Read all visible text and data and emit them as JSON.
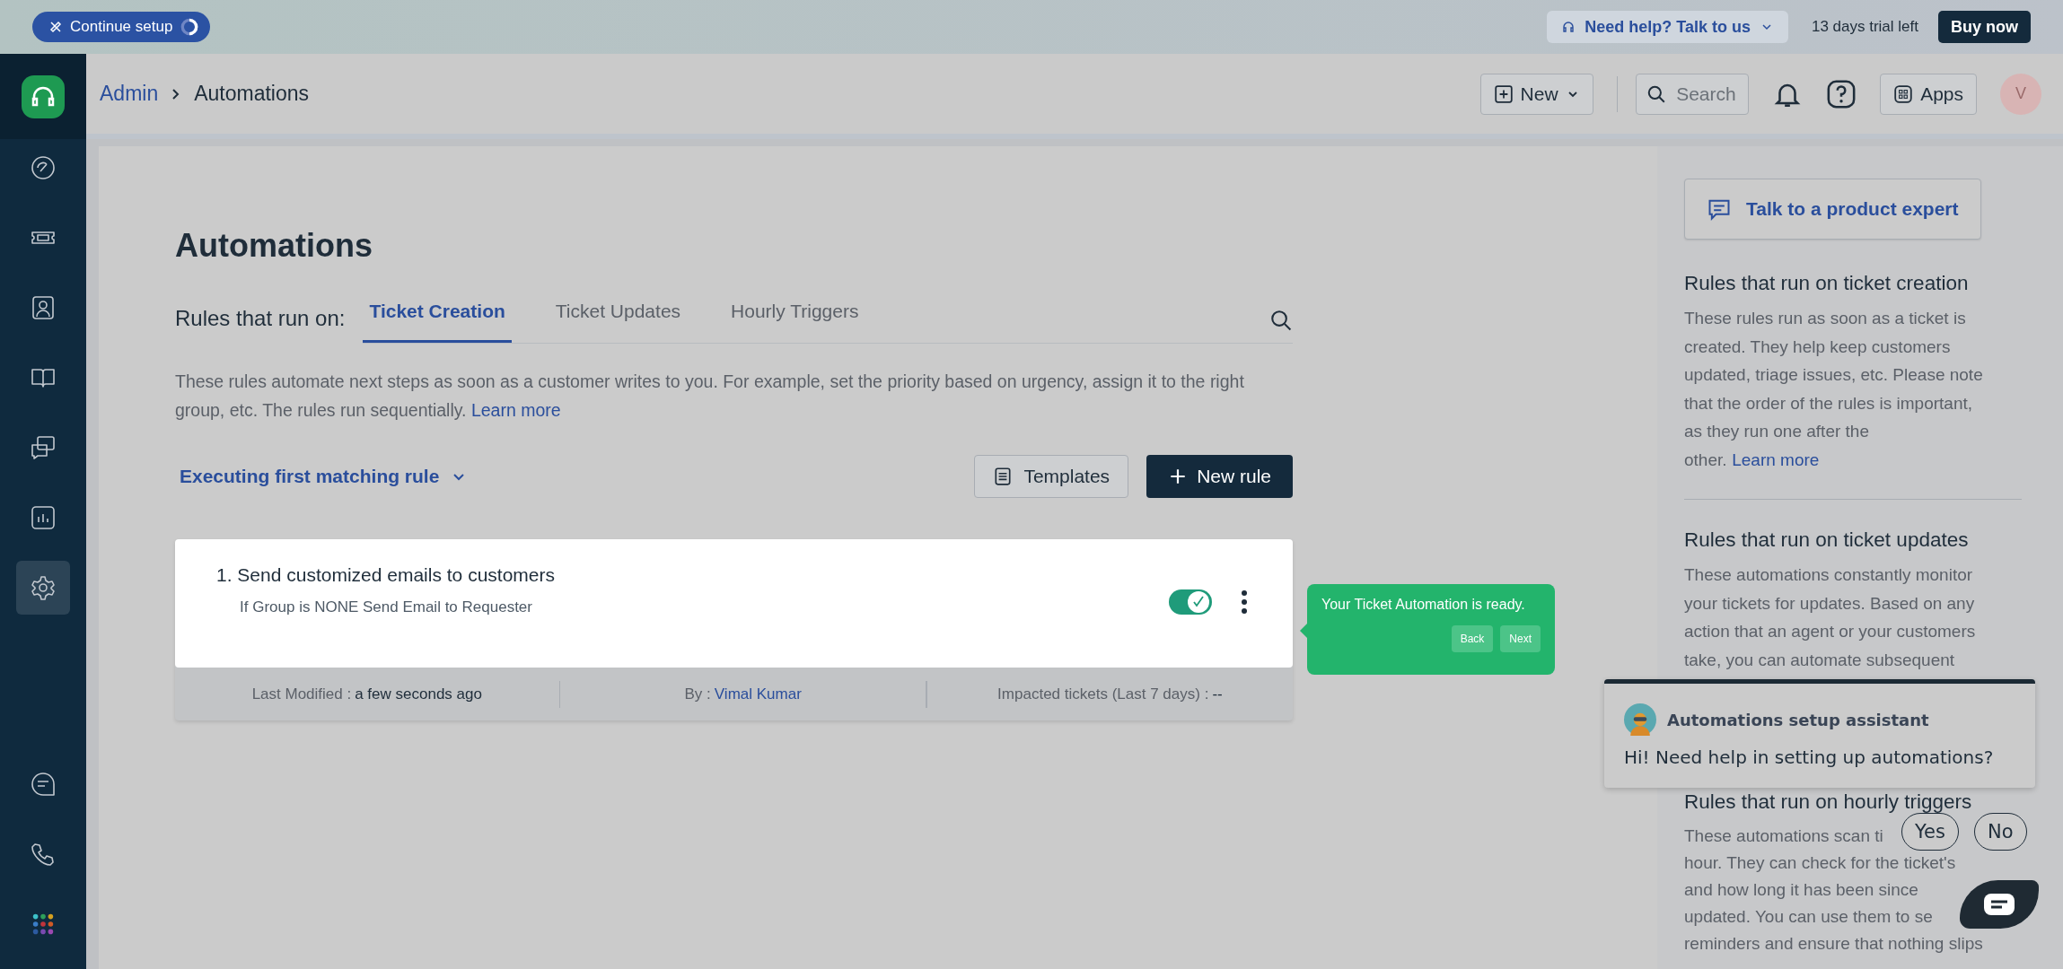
{
  "top_bar": {
    "setup_button": "Continue setup",
    "help_button": "Need help? Talk to us",
    "trial": "13 days trial left",
    "buy_button": "Buy now"
  },
  "sidebar": {
    "items": [
      {
        "kind": "dashboard",
        "selected": false
      },
      {
        "kind": "tickets",
        "selected": false
      },
      {
        "kind": "contacts",
        "selected": false
      },
      {
        "kind": "solutions",
        "selected": false
      },
      {
        "kind": "conversations",
        "selected": false
      },
      {
        "kind": "reports",
        "selected": false
      },
      {
        "kind": "admin",
        "selected": true
      }
    ],
    "bottom_items": [
      {
        "kind": "chat"
      },
      {
        "kind": "phone"
      },
      {
        "kind": "apps"
      }
    ]
  },
  "header": {
    "breadcrumb": [
      "Admin",
      "Automations"
    ],
    "new_button": "New",
    "search_placeholder": "Search",
    "apps_button": "Apps",
    "avatar": "V"
  },
  "page": {
    "title": "Automations",
    "tabs_label": "Rules that run on:",
    "tabs": [
      {
        "label": "Ticket Creation",
        "selected": true
      },
      {
        "label": "Ticket Updates",
        "selected": false
      },
      {
        "label": "Hourly Triggers",
        "selected": false
      }
    ],
    "description": "These rules automate next steps as soon as a customer writes to you. For example, set the priority based on urgency, assign it to the right group, etc. The rules run sequentially.",
    "learn_more": "Learn more",
    "execution_mode": "Executing first matching rule",
    "templates_button": "Templates",
    "new_rule_button": "New rule"
  },
  "rules": [
    {
      "number": "1.",
      "name": "Send customized emails to customers",
      "summary": "If Group is NONE Send Email to Requester",
      "enabled": true,
      "last_modified_label": "Last Modified :",
      "last_modified": "a few seconds ago",
      "by_label": "By :",
      "by": "Vimal Kumar",
      "impacted_label": "Impacted tickets (Last 7 days) :",
      "impacted": "--"
    }
  ],
  "tour_tooltip": {
    "text": "Your Ticket Automation is ready.",
    "back": "Back",
    "next": "Next"
  },
  "help_panel": {
    "expert_button": "Talk to a product expert",
    "sections": [
      {
        "title": "Rules that run on ticket creation",
        "lines": [
          "These rules run as soon as a ticket is created. They help keep customers updated, triage issues, etc. Please note that the order of the rules is important, as they run one after the other."
        ],
        "link": "Learn more"
      },
      {
        "title": "Rules that run on ticket updates",
        "lines": [
          "These automations constantly monitor your tickets for updates. Based on any action that an agent or your customers take, you can automate subsequent"
        ]
      },
      {
        "title": "Rules that run on hourly triggers",
        "lines": [
          "These automations scan ti",
          "hour. They can check for the ticket's",
          "and how long it has been since",
          "updated. You can use them to se",
          "reminders and ensure that nothing slips"
        ]
      }
    ]
  },
  "assistant": {
    "title": "Automations setup assistant",
    "message": "Hi! Need help in setting up automations?",
    "yes": "Yes",
    "no": "No"
  }
}
